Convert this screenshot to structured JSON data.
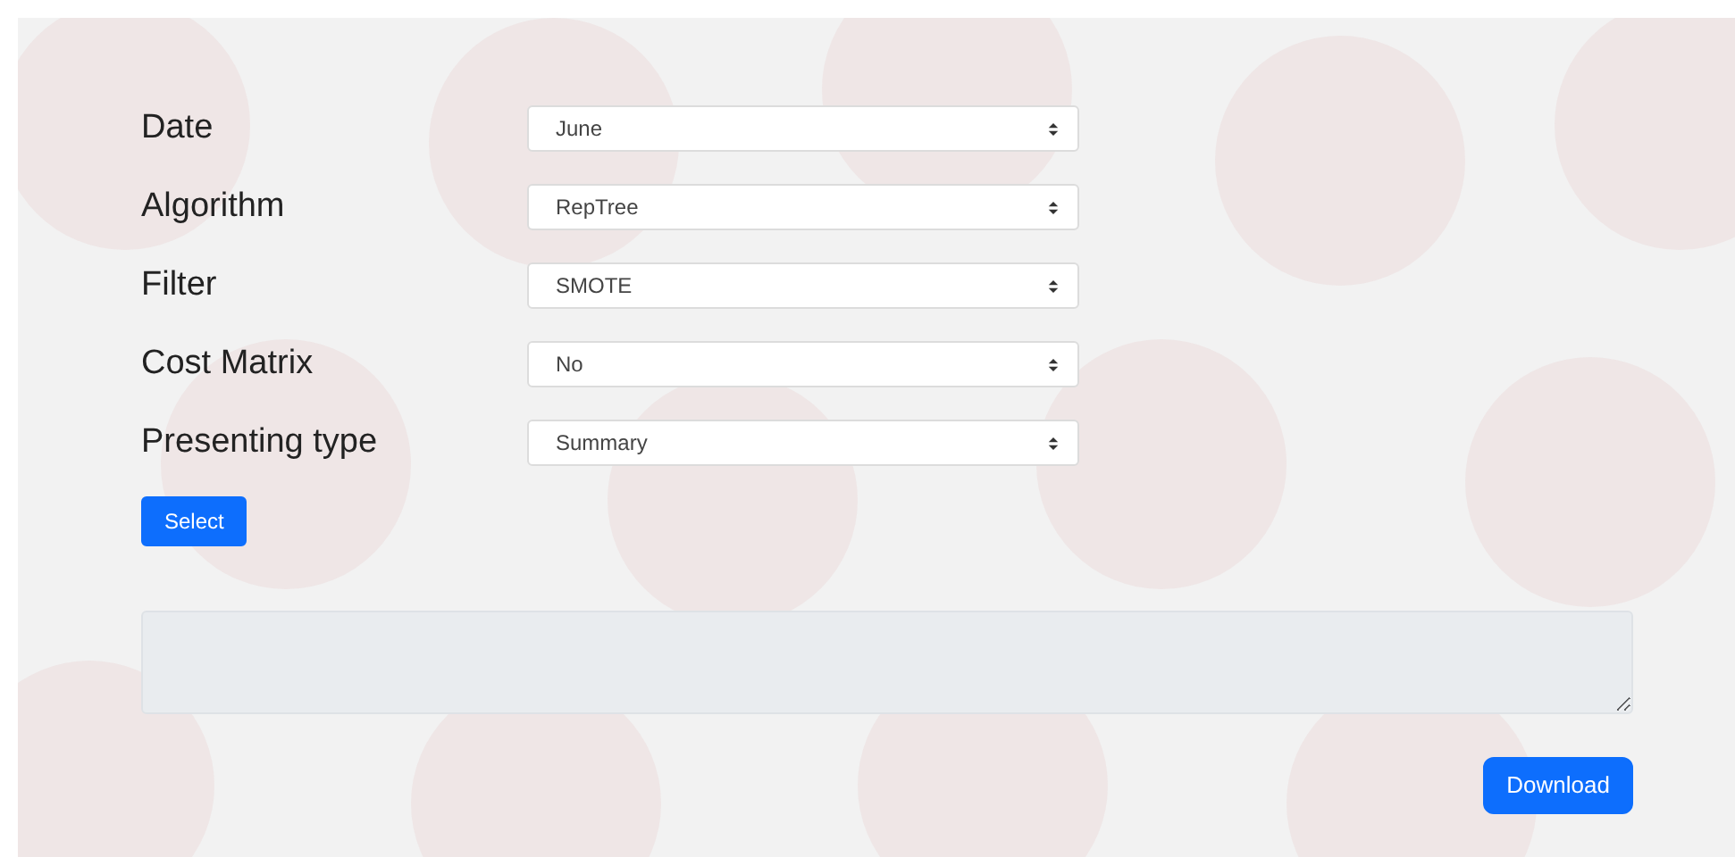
{
  "form": {
    "fields": [
      {
        "label": "Date",
        "value": "June"
      },
      {
        "label": "Algorithm",
        "value": "RepTree"
      },
      {
        "label": "Filter",
        "value": "SMOTE"
      },
      {
        "label": "Cost Matrix",
        "value": "No"
      },
      {
        "label": "Presenting type",
        "value": "Summary"
      }
    ],
    "submit_button": "Select"
  },
  "output": {
    "disabled": true
  },
  "download_button": "Download"
}
